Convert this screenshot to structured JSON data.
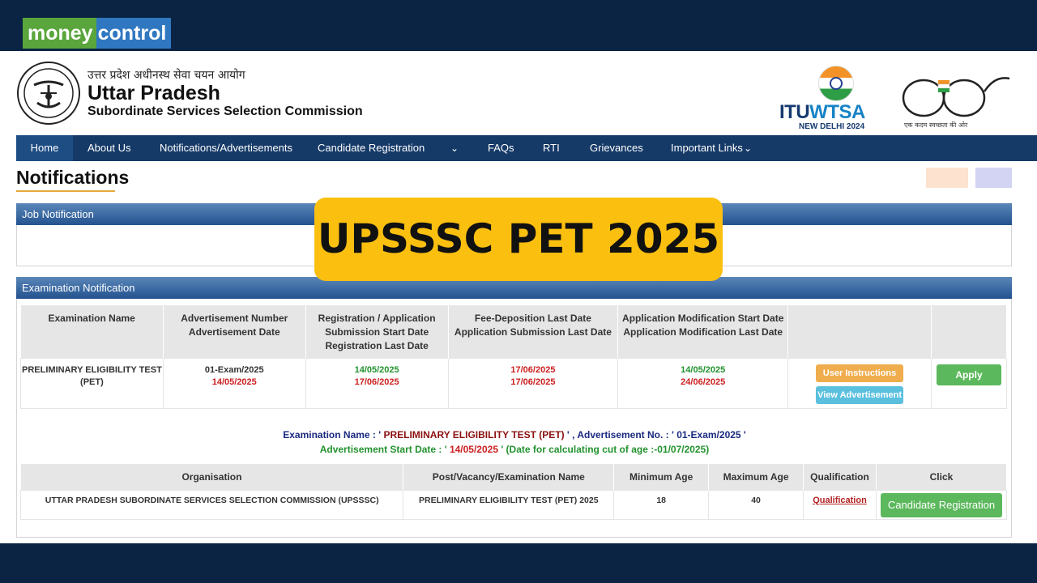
{
  "brand": {
    "part1": "money",
    "part2": "control"
  },
  "header": {
    "hindi_title": "उत्तर प्रदेश अधीनस्थ सेवा चयन आयोग",
    "title": "Uttar Pradesh",
    "subtitle": "Subordinate Services Selection Commission",
    "itu": {
      "part1": "ITU",
      "part2": "WTSA",
      "location": "NEW DELHI 2024"
    },
    "swachh": {
      "tagline": "एक कदम स्वच्छता की ओर"
    }
  },
  "nav": {
    "items": [
      "Home",
      "About Us",
      "Notifications/Advertisements",
      "Candidate Registration",
      "FAQs",
      "RTI",
      "Grievances",
      "Important Links"
    ]
  },
  "page_title": "Notifications",
  "job_panel": {
    "title": "Job Notification"
  },
  "exam_panel": {
    "title": "Examination Notification"
  },
  "exam_table": {
    "headers": [
      "Examination Name",
      "Advertisement Number\nAdvertisement Date",
      "Registration / Application Submission  Start Date\nRegistration Last Date",
      "Fee-Deposition Last Date\nApplication Submission Last Date",
      "Application Modification Start Date\nApplication Modification Last Date"
    ],
    "row": {
      "exam_name": "PRELIMINARY ELIGIBILITY TEST (PET)",
      "adv_number": "01-Exam/2025",
      "adv_date": "14/05/2025",
      "reg_start": "14/05/2025",
      "reg_last": "17/06/2025",
      "fee_last": "17/06/2025",
      "app_last": "17/06/2025",
      "mod_start": "14/05/2025",
      "mod_last": "24/06/2025",
      "user_instructions_label": "User Instructions",
      "view_adv_label": "View Advertisement",
      "apply_label": "Apply"
    }
  },
  "info": {
    "exam_label": "Examination Name : '",
    "exam_value": " PRELIMINARY ELIGIBILITY TEST (PET) ",
    "adv_label": "' , Advertisement No. : ' 01-Exam/2025 '",
    "start_label": "Advertisement Start Date : '",
    "start_value": " 14/05/2025 ",
    "start_suffix": "' (Date for calculating cut of age :-01/07/2025)"
  },
  "org_table": {
    "headers": [
      "Organisation",
      "Post/Vacancy/Examination Name",
      "Minimum Age",
      "Maximum Age",
      "Qualification",
      "Click"
    ],
    "row": {
      "organisation": "UTTAR PRADESH SUBORDINATE SERVICES SELECTION COMMISSION (UPSSSC)",
      "post": "PRELIMINARY ELIGIBILITY TEST (PET) 2025",
      "min_age": "18",
      "max_age": "40",
      "qualification_label": "Qualification",
      "register_label": "Candidate Registration"
    }
  },
  "banner": {
    "text": "UPSSSC PET 2025"
  },
  "colors": {
    "nav": "#163a68",
    "banner": "#fbbf0f",
    "accent_green": "#5cb85c",
    "accent_orange": "#f0ad4e"
  }
}
